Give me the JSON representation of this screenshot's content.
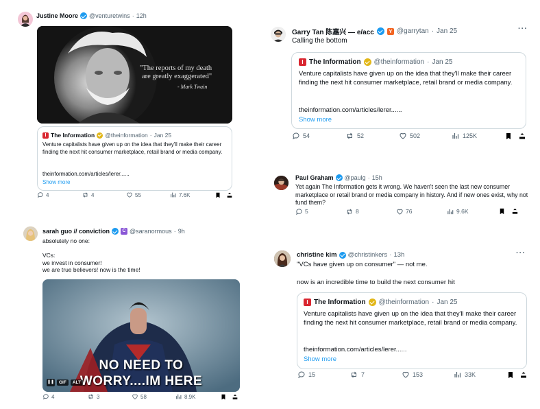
{
  "jm": {
    "name": "Justine Moore",
    "handle": "@venturetwins",
    "time": "12h",
    "quote_text": "\"The reports of my death\nare greatly exaggerated\"",
    "quote_author": "- Mark Twain",
    "qt_source": "The Information",
    "qt_handle": "@theinformation",
    "qt_time": "Jan 25",
    "qt_text": "Venture capitalists have given up on the idea that they'll make their career finding the next hit consumer marketplace, retail brand or media company.",
    "qt_link": "theinformation.com/articles/lerer......",
    "qt_more": "Show more",
    "replies": "4",
    "reposts": "4",
    "likes": "55",
    "views": "7.6K"
  },
  "gt": {
    "name": "Garry Tan 陈嘉兴 — e/acc",
    "handle": "@garrytan",
    "time": "Jan 25",
    "text": "Calling the bottom",
    "qt_source": "The Information",
    "qt_handle": "@theinformation",
    "qt_time": "Jan 25",
    "qt_text": "Venture capitalists have given up on the idea that they'll make their career finding the next hit consumer marketplace, retail brand or media company.",
    "qt_link": "theinformation.com/articles/lerer......",
    "qt_more": "Show more",
    "replies": "54",
    "reposts": "52",
    "likes": "502",
    "views": "125K"
  },
  "pg": {
    "name": "Paul Graham",
    "handle": "@paulg",
    "time": "15h",
    "text": "Yet again The Information gets it wrong. We haven't seen the last new consumer marketplace or retail brand or media company in history. And if new ones exist, why not fund them?",
    "replies": "5",
    "reposts": "8",
    "likes": "76",
    "views": "9.6K"
  },
  "sg": {
    "name": "sarah guo // conviction",
    "badge": "C",
    "handle": "@saranormous",
    "time": "9h",
    "text": "absolutely no one:\n\nVCs:\nwe invest in consumer!\nwe are true believers! now is the time!",
    "gif_caption_1": "NO NEED TO",
    "gif_caption_2": "WORRY....IM HERE",
    "gif_tag": "GIF",
    "alt_tag": "ALT",
    "replies": "4",
    "reposts": "3",
    "likes": "58",
    "views": "8.9K"
  },
  "ck": {
    "name": "christine kim",
    "handle": "@christinkers",
    "time": "13h",
    "text1": "\"VCs have given up on consumer\" — not me.",
    "text2": "now is an incredible time to build the next consumer hit",
    "qt_source": "The Information",
    "qt_handle": "@theinformation",
    "qt_time": "Jan 25",
    "qt_text": "Venture capitalists have given up on the idea that they'll make their career finding the next hit consumer marketplace, retail brand or media company.",
    "qt_link": "theinformation.com/articles/lerer......",
    "qt_more": "Show more",
    "replies": "15",
    "reposts": "7",
    "likes": "153",
    "views": "33K"
  },
  "icons": [
    "reply-icon",
    "repost-icon",
    "like-icon",
    "views-icon",
    "bookmark-icon",
    "share-icon",
    "verified-icon",
    "more-icon"
  ],
  "colors": {
    "accent": "#1d9bf0",
    "gold": "#e2b719",
    "info_red": "#d92630",
    "muted": "#536471"
  }
}
